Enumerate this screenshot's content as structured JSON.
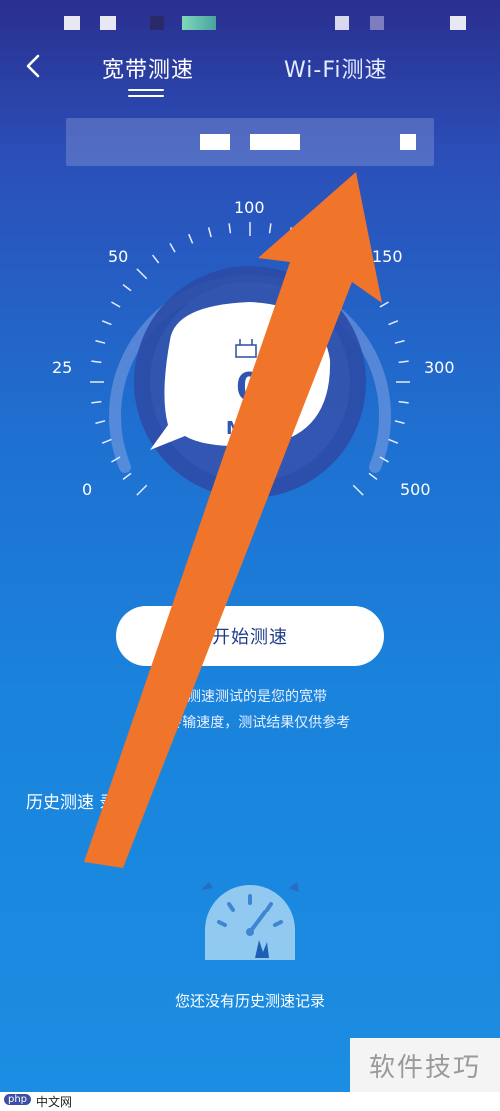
{
  "header": {
    "tabs": [
      {
        "label": "宽带测速",
        "active": true
      },
      {
        "label": "Wi-Fi测速",
        "active": false
      }
    ]
  },
  "gauge": {
    "scale_labels": [
      "0",
      "25",
      "50",
      "100",
      "150",
      "300",
      "500"
    ],
    "value": "0",
    "unit": "M"
  },
  "start_button": {
    "label": "开始测速"
  },
  "description": {
    "line1": "带测速测试的是您的宽带",
    "line2": "数 传输速度，测试结果仅供参考"
  },
  "history": {
    "title": "历史测速 录",
    "empty_text": "您还没有历史测速记录"
  },
  "watermarks": {
    "bottom_right": "软件技巧",
    "bottom_left_logo": "php",
    "bottom_left_text": "中文网"
  },
  "colors": {
    "accent_arrow": "#f0742a",
    "start_button_text": "#1f3c8a",
    "background_top": "#2a2f8f",
    "background_bottom": "#1b8ee2"
  },
  "icons": [
    "back-chevron-icon",
    "router-icon",
    "speedometer-icon"
  ]
}
